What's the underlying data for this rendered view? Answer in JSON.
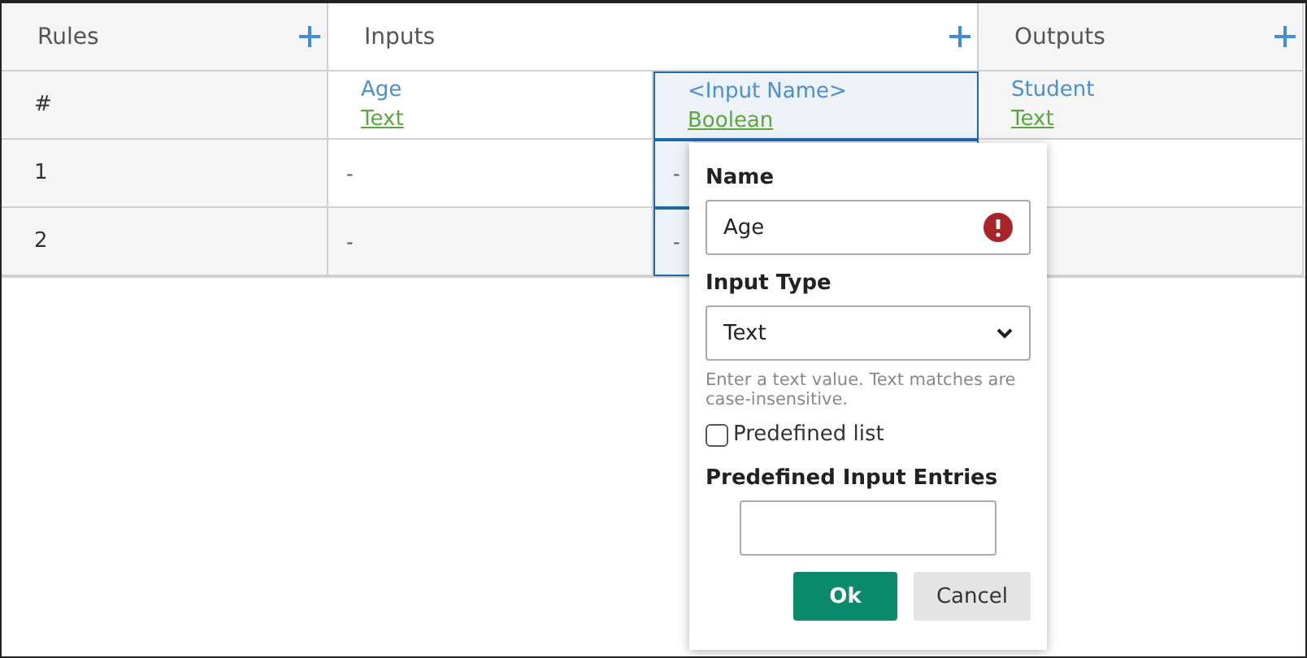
{
  "header": {
    "rules": "Rules",
    "inputs": "Inputs",
    "outputs": "Outputs"
  },
  "fields": [
    {
      "name": "Age",
      "type": "Text",
      "selected": false
    },
    {
      "name": "<Input Name>",
      "type": "Boolean",
      "selected": true
    },
    {
      "name": "Student",
      "type": "Text",
      "selected": false
    }
  ],
  "number_heading": "#",
  "rows": [
    {
      "number": "1",
      "cells": [
        "-",
        "-"
      ]
    },
    {
      "number": "2",
      "cells": [
        "-",
        "-"
      ]
    }
  ],
  "popup": {
    "name_label": "Name",
    "name_value": "Age",
    "name_error": true,
    "type_label": "Input Type",
    "type_value": "Text",
    "hint": "Enter a text value. Text matches are case-insensitive.",
    "predefined": {
      "label": "Predefined list",
      "checked": false
    },
    "entries_label": "Predefined Input Entries",
    "ok": "Ok",
    "cancel": "Cancel"
  }
}
